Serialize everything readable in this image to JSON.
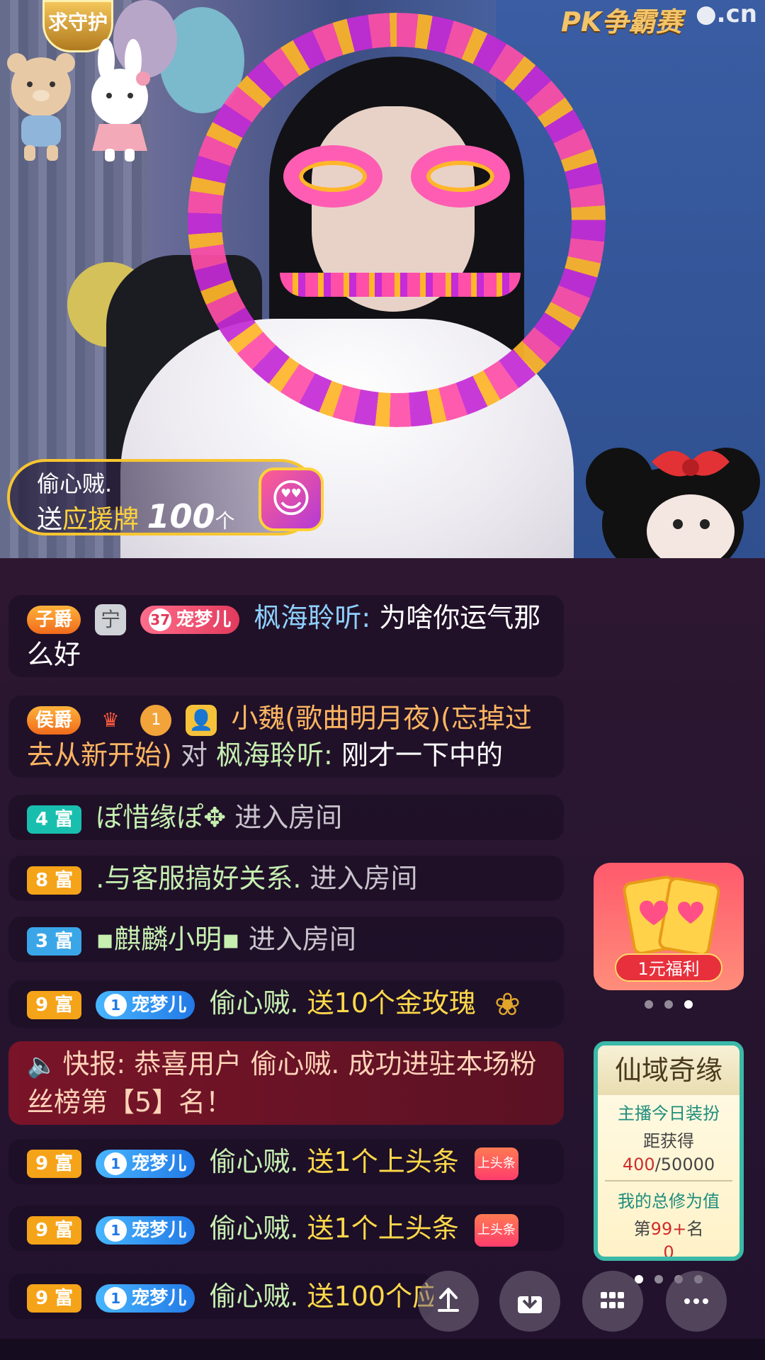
{
  "video": {
    "guard_logo": "求守护",
    "pk_logo": "PK争霸赛",
    "site_logo": "●.cn"
  },
  "gift_banner": {
    "sender": "偷心贼.",
    "verb": "送",
    "gift": "应援牌",
    "count": "100",
    "unit": "个"
  },
  "chat": [
    {
      "badge": "子爵",
      "fan_level": "37",
      "fan_name": "宠梦儿",
      "user": "枫海聆听:",
      "text": "为啥你运气那么好"
    },
    {
      "badge": "侯爵",
      "rank": "1",
      "user": "小魏(歌曲明月夜)(忘掉过去从新开始)",
      "to": "对",
      "target": "枫海聆听:",
      "text": "刚才一下中的"
    },
    {
      "badge": "4 富",
      "user": "ぽ惜缘ぽ✥",
      "text": "进入房间"
    },
    {
      "badge": "8 富",
      "user": ".与客服搞好关系.",
      "text": "进入房间"
    },
    {
      "badge": "3 富",
      "user": "▪麒麟小明▪",
      "text": "进入房间"
    },
    {
      "badge": "9 富",
      "fan_level": "1",
      "fan_name": "宠梦儿",
      "user": "偷心贼.",
      "text": "送10个金玫瑰"
    },
    {
      "broadcast": "快报: 恭喜用户 偷心贼. 成功进驻本场粉丝榜第【5】名！"
    },
    {
      "badge": "9 富",
      "fan_level": "1",
      "fan_name": "宠梦儿",
      "user": "偷心贼.",
      "text": "送1个上头条",
      "chip": "上头条"
    },
    {
      "badge": "9 富",
      "fan_level": "1",
      "fan_name": "宠梦儿",
      "user": "偷心贼.",
      "text": "送1个上头条",
      "chip": "上头条"
    },
    {
      "badge": "9 富",
      "fan_level": "1",
      "fan_name": "宠梦儿",
      "user": "偷心贼.",
      "text": "送100个应援牌"
    }
  ],
  "promo": {
    "label": "1元福利"
  },
  "anchor_card": {
    "title": "仙域奇缘",
    "line1": "主播今日装扮",
    "line2": "距获得",
    "progress_current": "400",
    "progress_total": "/50000",
    "line4": "我的总修为值",
    "rank_prefix": "第",
    "rank": "99+",
    "rank_suffix": "名",
    "value": "0"
  },
  "toolbar": {
    "icons": [
      "share-icon",
      "download-icon",
      "grid-icon",
      "more-icon"
    ]
  },
  "colors": {
    "accent_gold": "#ffd23a",
    "broadcast_bg": "#7a1428",
    "card_border": "#3bb9a8"
  }
}
